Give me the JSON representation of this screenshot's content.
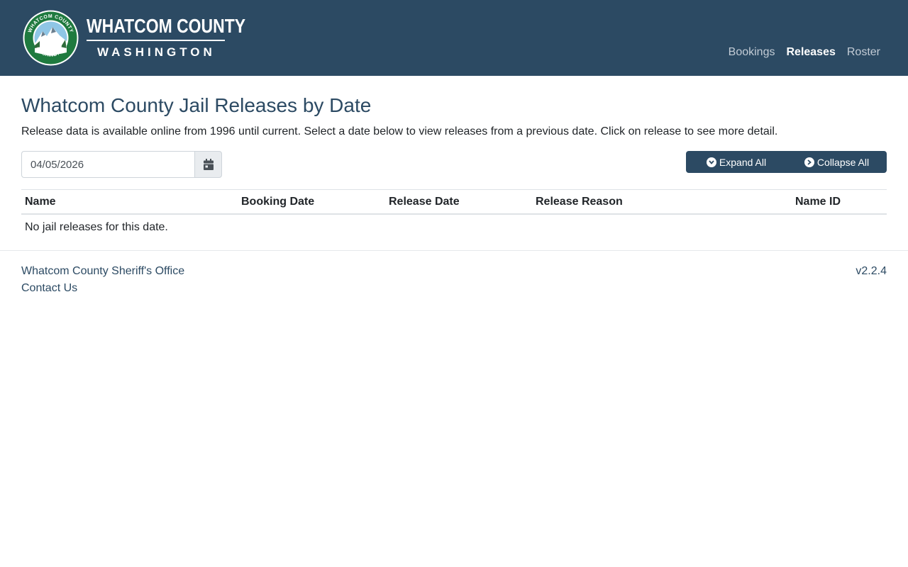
{
  "header": {
    "logo_top": "WHATCOM COUNTY",
    "logo_bottom": "WASHINGTON",
    "seal_text_top": "WHATCOM COUNTY",
    "seal_text_bottom": "WASHINGTON",
    "nav": [
      {
        "label": "Bookings",
        "active": false
      },
      {
        "label": "Releases",
        "active": true
      },
      {
        "label": "Roster",
        "active": false
      }
    ]
  },
  "main": {
    "title": "Whatcom County Jail Releases by Date",
    "description": "Release data is available online from 1996 until current. Select a date below to view releases from a previous date. Click on release to see more detail.",
    "date_value": "04/05/2026",
    "calendar_icon": "calendar-icon",
    "expand_label": "Expand All",
    "collapse_label": "Collapse All",
    "table": {
      "columns": [
        "Name",
        "Booking Date",
        "Release Date",
        "Release Reason",
        "Name ID"
      ],
      "empty_message": "No jail releases for this date."
    }
  },
  "footer": {
    "office_link": "Whatcom County Sheriff's Office",
    "contact_link": "Contact Us",
    "version": "v2.2.4"
  },
  "colors": {
    "navbar": "#2c4a63",
    "accent": "#2c4a63",
    "seal_green": "#1f7a3f"
  }
}
